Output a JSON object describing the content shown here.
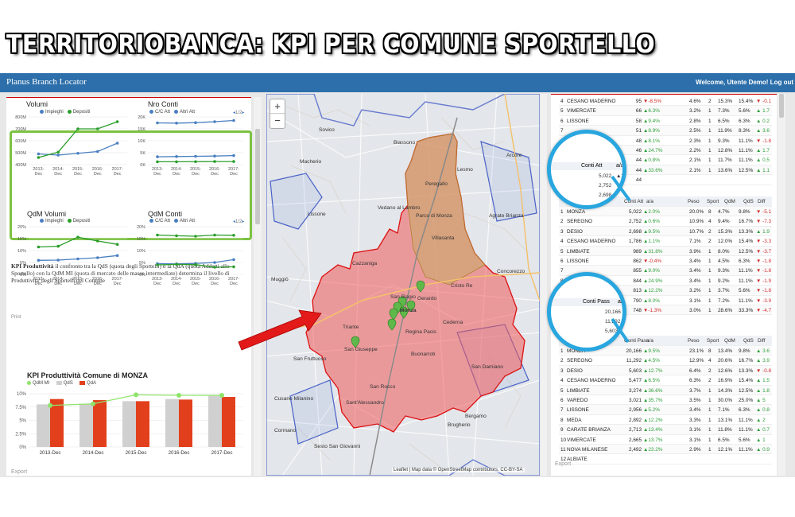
{
  "banner_title": "TERRITORIOBANCA: KPI PER COMUNE SPORTELLO",
  "app": {
    "brand": "Planus Branch Locator",
    "welcome": "Welcome, Utente Demo! Log out"
  },
  "colors": {
    "blue": "#4a7fc1",
    "green": "#2a9d2a",
    "orange": "#e2401c",
    "grey": "#d0d0d0",
    "highlight": "#7dc242",
    "callout": "#28a6df"
  },
  "left_panel": {
    "volumi": {
      "title": "Volumi",
      "legend": [
        "Impieghi",
        "Depositi"
      ],
      "categories": [
        "2013-Dec",
        "2014-Dec",
        "2015-Dec",
        "2016-Dec",
        "2017-Dec"
      ],
      "yticks": [
        "800M",
        "700M",
        "600M",
        "500M",
        "400M"
      ],
      "series": [
        {
          "name": "Impieghi",
          "values": [
            490,
            480,
            495,
            510,
            580
          ]
        },
        {
          "name": "Depositi",
          "values": [
            460,
            505,
            700,
            700,
            760
          ]
        }
      ]
    },
    "nro_conti": {
      "title": "Nro Conti",
      "legend": [
        "C/C Att",
        "Altri Att"
      ],
      "pager": "1/2",
      "categories": [
        "2013-Dec",
        "2014-Dec",
        "2015-Dec",
        "2016-Dec",
        "2017-Dec"
      ],
      "yticks": [
        "20K",
        "15K",
        "10K",
        "5K",
        "0K"
      ],
      "series": [
        {
          "name": "C/C Att",
          "values": [
            17500,
            17400,
            17600,
            18000,
            18500
          ]
        },
        {
          "name": "Altri Att",
          "values": [
            3300,
            3400,
            3500,
            3600,
            3800
          ]
        },
        {
          "name": "",
          "values": [
            1200,
            1200,
            1250,
            1300,
            1300
          ]
        }
      ]
    },
    "qdm_volumi": {
      "title": "QdM Volumi",
      "legend": [
        "Impieghi",
        "Depositi"
      ],
      "categories": [
        "2013-Dec",
        "2014-Dec",
        "2015-Dec",
        "2016-Dec",
        "2017-Dec"
      ],
      "yticks": [
        "20%",
        "15%",
        "10%",
        "5%",
        "0%"
      ],
      "series": [
        {
          "name": "Impieghi",
          "values": [
            5.9,
            6.0,
            6.5,
            7.0,
            7.9
          ]
        },
        {
          "name": "Depositi",
          "values": [
            11.5,
            11.8,
            15.6,
            14.0,
            12.6
          ]
        }
      ]
    },
    "qdm_conti": {
      "title": "QdM Conti",
      "legend": [
        "C/C Att",
        "Altri Att"
      ],
      "pager": "1/2",
      "categories": [
        "2013-Dec",
        "2014-Dec",
        "2015-Dec",
        "2016-Dec",
        "2017-Dec"
      ],
      "yticks": [
        "20%",
        "15%",
        "10%",
        "5%",
        "0%"
      ],
      "series": [
        {
          "name": "C/C Att",
          "values": [
            16.5,
            16.2,
            16.0,
            16.5,
            16.4
          ]
        },
        {
          "name": "Altri Att",
          "values": [
            4.5,
            4.4,
            4.6,
            5.0,
            6.2
          ]
        },
        {
          "name": "",
          "values": [
            4.0,
            4.2,
            4.1,
            3.0,
            3.2
          ]
        }
      ]
    },
    "print": "Print",
    "export": "Export",
    "kpi_text_bold": "KPI Produttività",
    "kpi_text": " il confronto tra la QdS (quota degli Sportelli) o la QdA (quota Addetti allo Sportello) con la QdM MI (quota di mercato delle masse intermediate) determina il livello di Produttivita' degli Sportelli del Comune",
    "kpi_chart": {
      "title": "KPI Produttività Comune di MONZA",
      "legend": [
        "QdM MI",
        "QdS",
        "QdA"
      ],
      "categories": [
        "2013-Dec",
        "2014-Dec",
        "2015-Dec",
        "2016-Dec",
        "2017-Dec"
      ],
      "yticks": [
        "10%",
        "7.5%",
        "5%",
        "2.5%",
        "0%"
      ],
      "series": [
        {
          "name": "QdM MI",
          "values": [
            7.8,
            8.1,
            9.8,
            9.7,
            9.7
          ]
        },
        {
          "name": "QdS",
          "values": [
            8.0,
            8.1,
            8.6,
            9.0,
            9.6
          ]
        },
        {
          "name": "QdA",
          "values": [
            9.0,
            8.8,
            8.6,
            8.9,
            9.4
          ]
        }
      ]
    }
  },
  "map": {
    "zoom_in": "+",
    "zoom_out": "−",
    "attribution": "Leaflet | Map data © OpenStreetMap contributors, CC-BY-SA",
    "labels": [
      "Biassono",
      "Arcore",
      "Lissone",
      "Villasanta",
      "Muggiò",
      "Monza",
      "Cazzaniga",
      "Cristo Re",
      "San Giuseppe",
      "Regina Pacis",
      "Cederna",
      "Triante",
      "San Fruttuoso",
      "Buonarroti",
      "Brugherio",
      "Sesto San Giovanni",
      "Parco di Monza",
      "San Rocco",
      "Sant'Alessandro",
      "Concorezzo",
      "Agrate Brianza",
      "Vedano al Lambro",
      "Lesmo",
      "Peregallo",
      "Macherio",
      "Sovico",
      "Cormano",
      "San Biagio",
      "Gerardo",
      "San Damiano",
      "Cusano Milanino",
      "Bergamo"
    ]
  },
  "right_panel": {
    "table1": {
      "rows": [
        [
          "4",
          "CESANO MADERNO",
          "95",
          "-8.5%",
          "dn",
          "4.6%",
          "2",
          "15.3%",
          "15.4%",
          "-0.1",
          "dn"
        ],
        [
          "5",
          "VIMERCATE",
          "66",
          "6.3%",
          "up",
          "3.2%",
          "1",
          "7.3%",
          "5.6%",
          "1.7",
          "up"
        ],
        [
          "6",
          "LISSONE",
          "58",
          "9.4%",
          "up",
          "2.8%",
          "1",
          "6.5%",
          "6.3%",
          "0.2",
          "up"
        ],
        [
          "7",
          "",
          "51",
          "8.9%",
          "up",
          "2.5%",
          "1",
          "11.9%",
          "8.3%",
          "3.6",
          "up"
        ],
        [
          "8",
          "",
          "48",
          "8.1%",
          "up",
          "2.3%",
          "1",
          "9.3%",
          "11.1%",
          "-1.8",
          "dn"
        ],
        [
          "9",
          "",
          "46",
          "24.7%",
          "up",
          "2.2%",
          "1",
          "12.8%",
          "11.1%",
          "1.7",
          "up"
        ],
        [
          "10",
          "",
          "44",
          "0.8%",
          "up",
          "2.1%",
          "1",
          "11.7%",
          "11.1%",
          "0.5",
          "up"
        ],
        [
          "11",
          "",
          "44",
          "33.6%",
          "up",
          "2.1%",
          "1",
          "13.6%",
          "12.5%",
          "1.1",
          "up"
        ],
        [
          "12",
          "",
          "44",
          "",
          "dn",
          "",
          "",
          "",
          "",
          "",
          "up"
        ]
      ]
    },
    "table2": {
      "headers": [
        "Comune",
        "Conti Att",
        "a/a",
        "Peso",
        "Sport",
        "QdM",
        "QdS",
        "Diff"
      ],
      "rows": [
        [
          "1",
          "MONZA",
          "5,022",
          "2.0%",
          "up",
          "20.0%",
          "8",
          "4.7%",
          "9.8%",
          "-5.1",
          "dn"
        ],
        [
          "2",
          "SEREGNO",
          "2,752",
          "0.6%",
          "up",
          "10.9%",
          "4",
          "9.4%",
          "16.7%",
          "-7.3",
          "dn"
        ],
        [
          "3",
          "DESIO",
          "2,698",
          "9.5%",
          "up",
          "10.7%",
          "2",
          "15.3%",
          "13.3%",
          "1.9",
          "up"
        ],
        [
          "4",
          "CESANO MADERNO",
          "1,786",
          "1.1%",
          "up",
          "7.1%",
          "2",
          "12.0%",
          "15.4%",
          "-3.3",
          "dn"
        ],
        [
          "5",
          "LIMBIATE",
          "989",
          "31.8%",
          "up",
          "3.9%",
          "1",
          "8.0%",
          "12.5%",
          "-3.7",
          "dn"
        ],
        [
          "6",
          "LISSONE",
          "862",
          "-0.4%",
          "dn",
          "3.4%",
          "1",
          "4.5%",
          "6.3%",
          "-1.8",
          "dn"
        ],
        [
          "7",
          "",
          "855",
          "9.0%",
          "up",
          "3.4%",
          "1",
          "9.3%",
          "11.1%",
          "-1.8",
          "dn"
        ],
        [
          "8",
          "",
          "844",
          "24.9%",
          "up",
          "3.4%",
          "1",
          "9.2%",
          "11.1%",
          "-1.9",
          "dn"
        ],
        [
          "9",
          "",
          "813",
          "12.2%",
          "up",
          "3.2%",
          "1",
          "3.7%",
          "5.6%",
          "-1.8",
          "dn"
        ],
        [
          "10",
          "",
          "790",
          "8.0%",
          "up",
          "3.1%",
          "1",
          "7.2%",
          "11.1%",
          "-3.9",
          "dn"
        ],
        [
          "11",
          "",
          "748",
          "-1.3%",
          "dn",
          "3.0%",
          "1",
          "28.6%",
          "33.3%",
          "-4.7",
          "dn"
        ]
      ]
    },
    "table3": {
      "headers": [
        "Comune",
        "Conti Pass",
        "a/a",
        "Peso",
        "Sport",
        "QdM",
        "QdS",
        "Diff"
      ],
      "rows": [
        [
          "1",
          "MONZA",
          "20,166",
          "9.5%",
          "up",
          "23.1%",
          "8",
          "13.4%",
          "9.8%",
          "3.6",
          "up"
        ],
        [
          "2",
          "SEREGNO",
          "11,292",
          "4.5%",
          "up",
          "12.9%",
          "4",
          "20.6%",
          "16.7%",
          "3.9",
          "up"
        ],
        [
          "3",
          "DESIO",
          "5,603",
          "12.7%",
          "up",
          "6.4%",
          "2",
          "12.6%",
          "13.3%",
          "-0.8",
          "dn"
        ],
        [
          "4",
          "CESANO MADERNO",
          "5,477",
          "6.5%",
          "up",
          "6.3%",
          "2",
          "16.9%",
          "15.4%",
          "1.5",
          "up"
        ],
        [
          "5",
          "LIMBIATE",
          "3,274",
          "36.6%",
          "up",
          "3.7%",
          "1",
          "14.3%",
          "12.5%",
          "1.8",
          "up"
        ],
        [
          "6",
          "VAREDO",
          "3,021",
          "35.7%",
          "up",
          "3.5%",
          "1",
          "30.0%",
          "25.0%",
          "5",
          "up"
        ],
        [
          "7",
          "LISSONE",
          "2,956",
          "5.2%",
          "up",
          "3.4%",
          "1",
          "7.1%",
          "6.3%",
          "0.8",
          "up"
        ],
        [
          "8",
          "MEDA",
          "2,892",
          "12.2%",
          "up",
          "3.3%",
          "1",
          "13.1%",
          "11.1%",
          "2",
          "up"
        ],
        [
          "9",
          "CARATE BRIANZA",
          "2,713",
          "13.4%",
          "up",
          "3.1%",
          "1",
          "11.8%",
          "11.1%",
          "0.7",
          "up"
        ],
        [
          "10",
          "VIMERCATE",
          "2,665",
          "13.7%",
          "up",
          "3.1%",
          "1",
          "6.5%",
          "5.6%",
          "1",
          "up"
        ],
        [
          "11",
          "NOVA MILANESE",
          "2,492",
          "23.2%",
          "up",
          "2.9%",
          "1",
          "12.1%",
          "11.1%",
          "0.9",
          "up"
        ],
        [
          "12",
          "ALBIATE",
          "",
          "",
          "up",
          "",
          "",
          "",
          "",
          "",
          "up"
        ]
      ]
    },
    "export": "Export",
    "lens1": {
      "header": "Conti Att",
      "aa": "a/a",
      "rows": [
        [
          "5,022",
          "2.0%"
        ],
        [
          "2,752",
          "0.6%"
        ],
        [
          "2,698",
          ""
        ]
      ]
    },
    "lens2": {
      "header": "Conti Pass",
      "aa": "a/a",
      "rows": [
        [
          "20,166",
          "9.5%"
        ],
        [
          "11,292",
          "4.5%"
        ],
        [
          "5,603",
          ""
        ]
      ]
    }
  }
}
